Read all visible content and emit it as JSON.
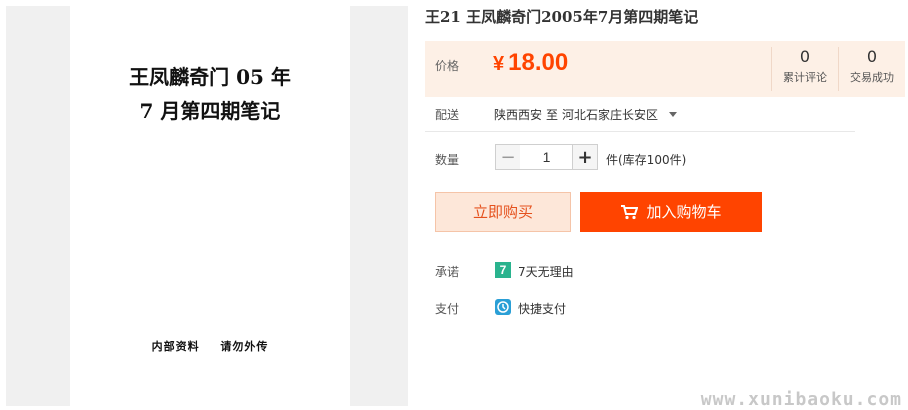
{
  "gallery": {
    "doc_title_line1": "王凤麟奇门 05 年",
    "doc_title_line2": "7 月第四期笔记",
    "doc_footer_left": "内部资料",
    "doc_footer_right": "请勿外传"
  },
  "product": {
    "title": "王21 王凤麟奇门2005年7月第四期笔记"
  },
  "price": {
    "label": "价格",
    "currency": "¥",
    "value": "18.00",
    "color": "#ff4400"
  },
  "stats": {
    "reviews_count": "0",
    "reviews_label": "累计评论",
    "sales_count": "0",
    "sales_label": "交易成功"
  },
  "shipping": {
    "label": "配送",
    "from": "陕西西安",
    "to_word": "至",
    "to": "河北石家庄长安区"
  },
  "quantity": {
    "label": "数量",
    "minus": "−",
    "value": "1",
    "plus": "+",
    "stock": "件(库存100件)"
  },
  "actions": {
    "buy_now": "立即购买",
    "add_to_cart": "加入购物车"
  },
  "promise": {
    "label": "承诺",
    "badge": "7",
    "text": "7天无理由"
  },
  "payment": {
    "label": "支付",
    "text": "快捷支付"
  },
  "watermark": "www.xunibaoku.com"
}
